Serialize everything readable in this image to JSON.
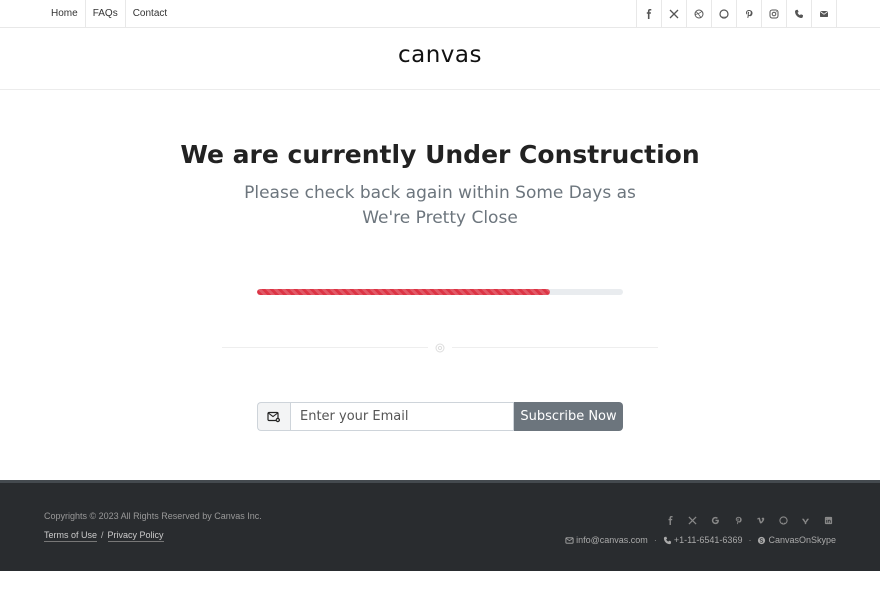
{
  "topbar": {
    "nav": [
      "Home",
      "FAQs",
      "Contact"
    ],
    "social_icons": [
      "facebook-icon",
      "x-icon",
      "dribbble-icon",
      "github-icon",
      "pinterest-icon",
      "instagram-icon",
      "phone-icon",
      "envelope-icon"
    ]
  },
  "header": {
    "logo": "canvas"
  },
  "main": {
    "headline": "We are currently Under Construction",
    "subline": "Please check back again within Some Days as We're Pretty Close",
    "progress": {
      "value": 0.8,
      "color": "#dc3545"
    },
    "subscribe": {
      "placeholder": "Enter your Email",
      "button": "Subscribe Now"
    }
  },
  "footer": {
    "copyright": "Copyrights © 2023 All Rights Reserved by Canvas Inc.",
    "links": [
      "Terms of Use",
      "Privacy Policy"
    ],
    "link_separator": "/",
    "social_icons": [
      "facebook-icon",
      "x-icon",
      "google-icon",
      "pinterest-icon",
      "vimeo-icon",
      "github-icon",
      "yahoo-icon",
      "linkedin-icon"
    ],
    "email": "info@canvas.com",
    "phone": "+1-11-6541-6369",
    "skype": "CanvasOnSkype"
  },
  "colors": {
    "accent_red": "#dc3545",
    "button_gray": "#6c757d",
    "footer_bg": "#292c2f"
  }
}
